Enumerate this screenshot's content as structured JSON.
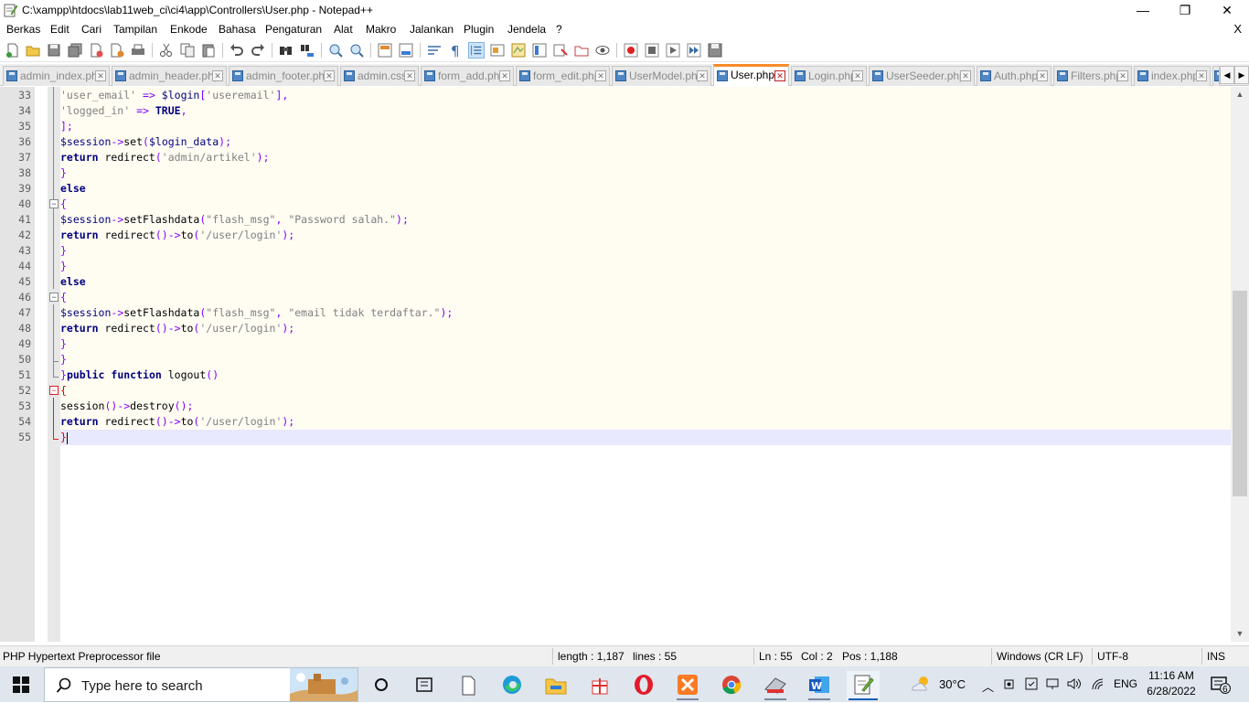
{
  "window": {
    "title": "C:\\xampp\\htdocs\\lab11web_ci\\ci4\\app\\Controllers\\User.php - Notepad++",
    "minimize": "—",
    "maximize": "❐",
    "close": "✕"
  },
  "menu": {
    "items": [
      "Berkas",
      "Edit",
      "Cari",
      "Tampilan",
      "Enkode",
      "Bahasa",
      "Pengaturan",
      "Alat",
      "Makro",
      "Jalankan",
      "Plugin",
      "Jendela",
      "?"
    ],
    "close_doc": "X"
  },
  "tabs": [
    {
      "label": "admin_index.php",
      "active": false
    },
    {
      "label": "admin_header.php",
      "active": false
    },
    {
      "label": "admin_footer.php",
      "active": false
    },
    {
      "label": "admin.css",
      "active": false
    },
    {
      "label": "form_add.php",
      "active": false
    },
    {
      "label": "form_edit.php",
      "active": false
    },
    {
      "label": "UserModel.php",
      "active": false
    },
    {
      "label": "User.php",
      "active": true
    },
    {
      "label": "Login.php",
      "active": false
    },
    {
      "label": "UserSeeder.php",
      "active": false
    },
    {
      "label": "Auth.php",
      "active": false
    },
    {
      "label": "Filters.php",
      "active": false
    },
    {
      "label": "index.php",
      "active": false
    }
  ],
  "editor": {
    "lines": [
      {
        "n": "33",
        "tokens": [
          [
            "str",
            "'user_email'"
          ],
          [
            "op",
            " => "
          ],
          [
            "var",
            "$login"
          ],
          [
            "op",
            "["
          ],
          [
            "str",
            "'useremail'"
          ],
          [
            "op",
            "],"
          ]
        ]
      },
      {
        "n": "34",
        "tokens": [
          [
            "str",
            "'logged_in'"
          ],
          [
            "op",
            " => "
          ],
          [
            "kw",
            "TRUE"
          ],
          [
            "op",
            ","
          ]
        ]
      },
      {
        "n": "35",
        "tokens": [
          [
            "op",
            "];"
          ]
        ]
      },
      {
        "n": "36",
        "tokens": [
          [
            "var",
            "$session"
          ],
          [
            "op",
            "->"
          ],
          [
            "fn",
            "set"
          ],
          [
            "op",
            "("
          ],
          [
            "var",
            "$login_data"
          ],
          [
            "op",
            ");"
          ]
        ]
      },
      {
        "n": "37",
        "tokens": [
          [
            "kw",
            "return"
          ],
          [
            "fn",
            " redirect"
          ],
          [
            "op",
            "("
          ],
          [
            "str",
            "'admin/artikel'"
          ],
          [
            "op",
            ");"
          ]
        ]
      },
      {
        "n": "38",
        "tokens": [
          [
            "op",
            "}"
          ]
        ]
      },
      {
        "n": "39",
        "tokens": [
          [
            "kw",
            "else"
          ]
        ]
      },
      {
        "n": "40",
        "tokens": [
          [
            "op",
            "{"
          ]
        ]
      },
      {
        "n": "41",
        "tokens": [
          [
            "var",
            "$session"
          ],
          [
            "op",
            "->"
          ],
          [
            "fn",
            "setFlashdata"
          ],
          [
            "op",
            "("
          ],
          [
            "str",
            "\"flash_msg\""
          ],
          [
            "op",
            ", "
          ],
          [
            "str",
            "\"Password salah.\""
          ],
          [
            "op",
            ");"
          ]
        ]
      },
      {
        "n": "42",
        "tokens": [
          [
            "kw",
            "return"
          ],
          [
            "fn",
            " redirect"
          ],
          [
            "op",
            "()->"
          ],
          [
            "fn",
            "to"
          ],
          [
            "op",
            "("
          ],
          [
            "str",
            "'/user/login'"
          ],
          [
            "op",
            ");"
          ]
        ]
      },
      {
        "n": "43",
        "tokens": [
          [
            "op",
            "}"
          ]
        ]
      },
      {
        "n": "44",
        "tokens": [
          [
            "op",
            "}"
          ]
        ]
      },
      {
        "n": "45",
        "tokens": [
          [
            "kw",
            "else"
          ]
        ]
      },
      {
        "n": "46",
        "tokens": [
          [
            "op",
            "{"
          ]
        ]
      },
      {
        "n": "47",
        "tokens": [
          [
            "var",
            "$session"
          ],
          [
            "op",
            "->"
          ],
          [
            "fn",
            "setFlashdata"
          ],
          [
            "op",
            "("
          ],
          [
            "str",
            "\"flash_msg\""
          ],
          [
            "op",
            ", "
          ],
          [
            "str",
            "\"email tidak terdaftar.\""
          ],
          [
            "op",
            ");"
          ]
        ]
      },
      {
        "n": "48",
        "tokens": [
          [
            "kw",
            "return"
          ],
          [
            "fn",
            " redirect"
          ],
          [
            "op",
            "()->"
          ],
          [
            "fn",
            "to"
          ],
          [
            "op",
            "("
          ],
          [
            "str",
            "'/user/login'"
          ],
          [
            "op",
            ");"
          ]
        ]
      },
      {
        "n": "49",
        "tokens": [
          [
            "op",
            "}"
          ]
        ]
      },
      {
        "n": "50",
        "tokens": [
          [
            "op",
            "}"
          ]
        ]
      },
      {
        "n": "51",
        "tokens": [
          [
            "op",
            "}"
          ],
          [
            "kw",
            "public function"
          ],
          [
            "fn",
            " logout"
          ],
          [
            "op",
            "()"
          ]
        ]
      },
      {
        "n": "52",
        "tokens": [
          [
            "hd",
            "{"
          ]
        ]
      },
      {
        "n": "53",
        "tokens": [
          [
            "fn",
            "session"
          ],
          [
            "op",
            "()->"
          ],
          [
            "fn",
            "destroy"
          ],
          [
            "op",
            "();"
          ]
        ]
      },
      {
        "n": "54",
        "tokens": [
          [
            "kw",
            "return"
          ],
          [
            "fn",
            " redirect"
          ],
          [
            "op",
            "()->"
          ],
          [
            "fn",
            "to"
          ],
          [
            "op",
            "("
          ],
          [
            "str",
            "'/user/login'"
          ],
          [
            "op",
            ");"
          ]
        ]
      },
      {
        "n": "55",
        "tokens": [
          [
            "hd",
            "}"
          ]
        ]
      }
    ]
  },
  "status": {
    "filetype": "PHP Hypertext Preprocessor file",
    "length": "length : 1,187",
    "lines": "lines : 55",
    "ln": "Ln : 55",
    "col": "Col : 2",
    "pos": "Pos : 1,188",
    "eol": "Windows (CR LF)",
    "encoding": "UTF-8",
    "mode": "INS"
  },
  "taskbar": {
    "search_placeholder": "Type here to search",
    "weather": "30°C",
    "lang": "ENG",
    "time": "11:16 AM",
    "date": "6/28/2022",
    "notifications": "6"
  },
  "colors": {
    "accent_tab": "#fa8b28",
    "keyword": "#000080",
    "operator": "#8000ff",
    "string": "#808080",
    "current_line": "#e8e8ff"
  }
}
